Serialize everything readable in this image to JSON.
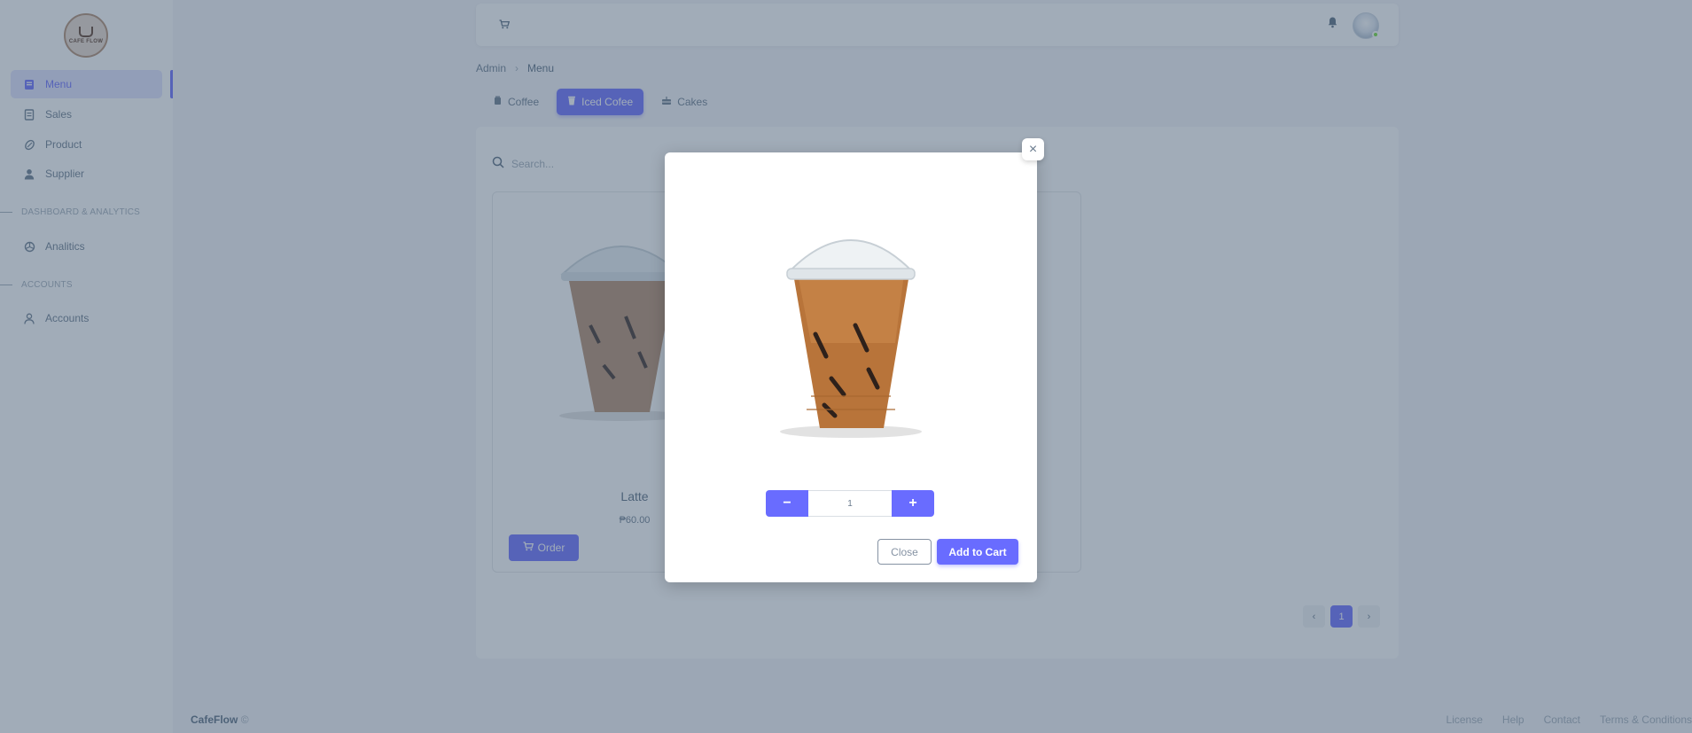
{
  "sidebar": {
    "logo_text": "CAFE FLOW",
    "items": [
      {
        "label": "Menu",
        "icon": "book-icon"
      },
      {
        "label": "Sales",
        "icon": "receipt-icon"
      },
      {
        "label": "Product",
        "icon": "coffee-bean-icon"
      },
      {
        "label": "Supplier",
        "icon": "user-icon"
      },
      {
        "label": "Analitics",
        "icon": "chart-pie-icon"
      },
      {
        "label": "Accounts",
        "icon": "person-icon"
      }
    ],
    "section_dashboard": "DASHBOARD & ANALYTICS",
    "section_accounts": "ACCOUNTS"
  },
  "breadcrumb": {
    "root": "Admin",
    "separator": "›",
    "current": "Menu"
  },
  "tabs": [
    {
      "label": "Coffee",
      "icon": "coffee-cup-icon"
    },
    {
      "label": "Iced Cofee",
      "icon": "iced-cup-icon"
    },
    {
      "label": "Cakes",
      "icon": "cake-icon"
    }
  ],
  "search": {
    "placeholder": "Search..."
  },
  "product": {
    "name": "Latte",
    "price": "₱60.00",
    "order_label": "Order"
  },
  "pagination": {
    "prev": "‹",
    "current": "1",
    "next": "›"
  },
  "footer": {
    "brand": "CafeFlow",
    "mark": "©",
    "links": [
      "License",
      "Help",
      "Contact",
      "Terms & Conditions"
    ]
  },
  "modal": {
    "close_symbol": "×",
    "minus": "−",
    "plus": "+",
    "quantity": "1",
    "close_label": "Close",
    "add_label": "Add to Cart"
  },
  "colors": {
    "primary": "#696cff",
    "overlay": "rgba(67,89,113,0.5)",
    "text": "#566a7f"
  }
}
